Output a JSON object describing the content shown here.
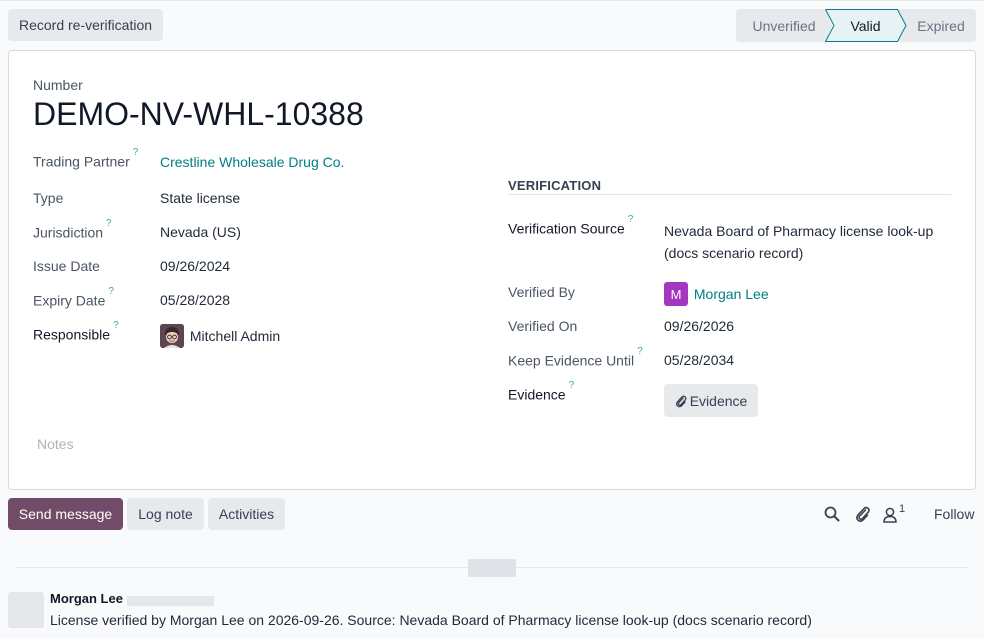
{
  "control": {
    "record_button": "Record re-verification",
    "statuses": [
      "Unverified",
      "Valid",
      "Expired"
    ],
    "active_status": "Valid"
  },
  "form": {
    "number_label": "Number",
    "number": "DEMO-NV-WHL-10388",
    "left": {
      "trading_partner_label": "Trading Partner",
      "trading_partner": "Crestline Wholesale Drug Co.",
      "type_label": "Type",
      "type": "State license",
      "jurisdiction_label": "Jurisdiction",
      "jurisdiction": "Nevada (US)",
      "issue_date_label": "Issue Date",
      "issue_date": "09/26/2024",
      "expiry_date_label": "Expiry Date",
      "expiry_date": "05/28/2028",
      "responsible_label": "Responsible",
      "responsible": "Mitchell Admin"
    },
    "verification": {
      "section_title": "VERIFICATION",
      "source_label": "Verification Source",
      "source_line1": "Nevada Board of Pharmacy license look-up",
      "source_line2": "(docs scenario record)",
      "verified_by_label": "Verified By",
      "verified_by_initial": "M",
      "verified_by": "Morgan Lee",
      "verified_on_label": "Verified On",
      "verified_on": "09/26/2026",
      "keep_until_label": "Keep Evidence Until",
      "keep_until": "05/28/2034",
      "evidence_label": "Evidence",
      "evidence_button": "Evidence"
    },
    "help_mark": "?",
    "notes_placeholder": "Notes"
  },
  "chatter": {
    "send_message": "Send message",
    "log_note": "Log note",
    "activities": "Activities",
    "followers_count": "1",
    "follow": "Follow",
    "message": {
      "author": "Morgan Lee",
      "body": "License verified by Morgan Lee on 2026-09-26. Source: Nevada Board of Pharmacy license look-up (docs scenario record)"
    }
  },
  "colors": {
    "primary": "#714b67",
    "link": "#017e84",
    "help": "#3aa6b3",
    "avatar_m": "#a437bf"
  },
  "icons": [
    "search-icon",
    "paperclip-icon",
    "user-icon"
  ]
}
